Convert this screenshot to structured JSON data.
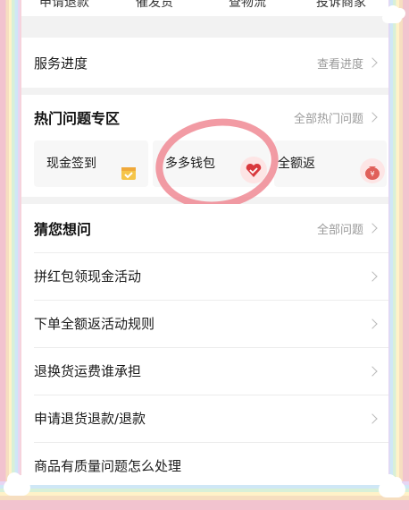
{
  "top_actions": [
    "申请退款",
    "催发货",
    "查物流",
    "投诉商家"
  ],
  "service_progress": {
    "label": "服务进度",
    "link": "查看进度"
  },
  "hot_section": {
    "title": "热门问题专区",
    "link": "全部热门问题",
    "items": [
      {
        "label": "现金签到",
        "icon": "calendar-check-icon"
      },
      {
        "label": "多多钱包",
        "icon": "heart-wallet-icon"
      },
      {
        "label": "全额返",
        "icon": "money-bag-icon",
        "icon_text": "¥"
      }
    ]
  },
  "faq_section": {
    "title": "猜您想问",
    "link": "全部问题",
    "items": [
      "拼红包领现金活动",
      "下单全额返活动规则",
      "退换货运费谁承担",
      "申请退货退款/退款",
      "商品有质量问题怎么处理"
    ]
  },
  "colors": {
    "annotation_circle": "#f08a94",
    "background": "#f6d3dc"
  }
}
